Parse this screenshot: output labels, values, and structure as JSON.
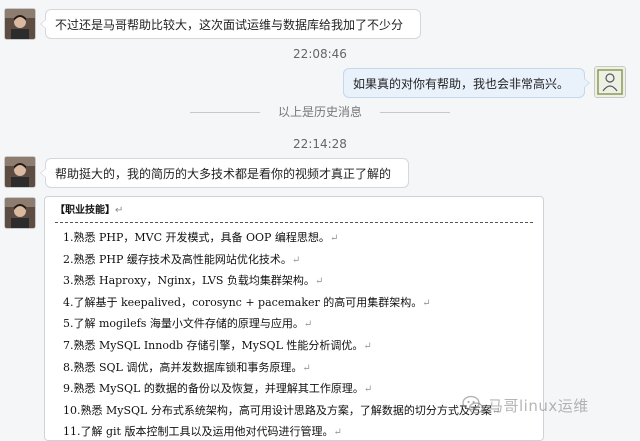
{
  "messages": [
    {
      "side": "left",
      "text": "不过还是马哥帮助比较大，这次面试运维与数据库给我加了不少分"
    },
    {
      "side": "right",
      "text": "如果真的对你有帮助，我也会非常高兴。"
    },
    {
      "side": "left",
      "text": "帮助挺大的，我的简历的大多技术都是看你的视频才真正了解的"
    }
  ],
  "timestamps": [
    "22:08:46",
    "22:14:28"
  ],
  "history_divider": "以上是历史消息",
  "resume": {
    "heading": "【职业技能】",
    "return_mark": "↵",
    "items": [
      "1.熟悉 PHP，MVC 开发模式，具备 OOP 编程思想。",
      "2.熟悉 PHP 缓存技术及高性能网站优化技术。",
      "3.熟悉 Haproxy，Nginx，LVS 负载均集群架构。",
      "4.了解基于 keepalived，corosync + pacemaker 的高可用集群架构。",
      "5.了解 mogilefs 海量小文件存储的原理与应用。",
      "7.熟悉 MySQL Innodb 存储引擎，MySQL 性能分析调优。",
      "8.熟悉 SQL 调优，高并发数据库锁和事务原理。",
      "9.熟悉 MySQL 的数据的备份以及恢复，并理解其工作原理。",
      "10.熟悉 MySQL 分布式系统架构，高可用设计思路及方案，了解数据的切分方式及方案",
      "11.了解 git 版本控制工具以及运用他对代码进行管理。"
    ]
  },
  "watermark": "马哥linux运维",
  "icons": {
    "left_avatar": "user-avatar-icon",
    "right_avatar": "contact-avatar-icon",
    "watermark_logo": "wechat-logo-icon"
  },
  "colors": {
    "background": "#f5f6f8",
    "left_bubble": "#ffffff",
    "right_bubble": "#e9f1fb"
  }
}
